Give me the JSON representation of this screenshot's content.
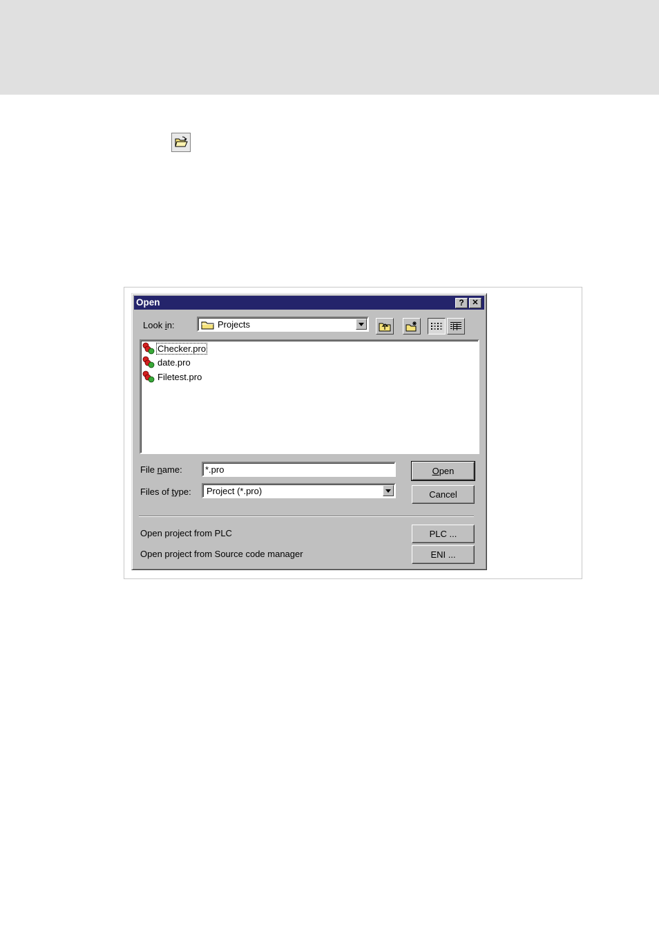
{
  "toolbar_icon": {
    "icon": "open-folder-icon"
  },
  "dialog": {
    "title": "Open",
    "help_label": "?",
    "close_label": "✕",
    "look_in": {
      "label_pre": "Look ",
      "label_key": "i",
      "label_post": "n:",
      "value": "Projects",
      "icon": "folder-icon"
    },
    "tools": [
      "up-one-level-icon",
      "create-new-folder-icon",
      "list-view-icon",
      "details-view-icon"
    ],
    "files": [
      {
        "name": "Checker.pro",
        "focused": true
      },
      {
        "name": "date.pro",
        "focused": false
      },
      {
        "name": "Filetest.pro",
        "focused": false
      }
    ],
    "file_name": {
      "label_pre": "File ",
      "label_key": "n",
      "label_post": "ame:",
      "value": "*.pro"
    },
    "file_type": {
      "label_pre": "Files of ",
      "label_key": "t",
      "label_post": "ype:",
      "value": "Project (*.pro)"
    },
    "open_button": {
      "key": "O",
      "rest": "pen"
    },
    "cancel_button": "Cancel",
    "plc_text": "Open project from PLC",
    "plc_button": "PLC ...",
    "eni_text": "Open project from Source code manager",
    "eni_button": "ENI ..."
  }
}
